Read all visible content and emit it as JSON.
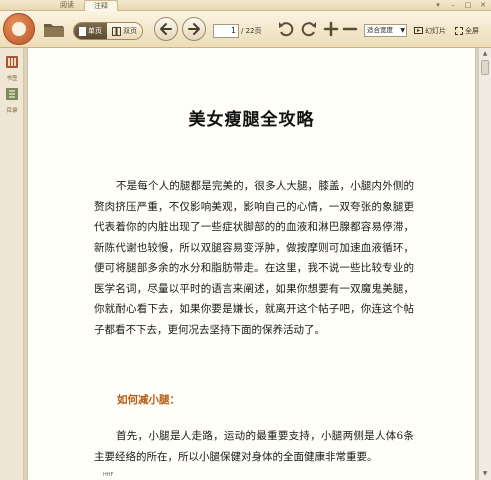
{
  "tabs": {
    "read": "阅读",
    "note": "注释"
  },
  "window_controls": {
    "menu": "▾",
    "minimize": "–",
    "maximize": "□",
    "close": "✕"
  },
  "toolbar": {
    "single_page": "单页",
    "double_page": "双页",
    "current_page": "1",
    "total_pages": "/ 22页",
    "zoom_mode": "适合宽度",
    "slideshow": "幻灯片",
    "fullscreen": "全屏"
  },
  "sidebar": {
    "items": [
      {
        "label": "书签",
        "icon": "bookmark-icon"
      },
      {
        "label": "目录",
        "icon": "toc-icon"
      }
    ]
  },
  "document": {
    "title": "美女瘦腿全攻略",
    "paragraph1": "不是每个人的腿都是完美的，很多人大腿，膝盖，小腿内外侧的赘肉挤压严重，不仅影响美观，影响自己的心情，一双夸张的象腿更代表着你的内脏出现了一些症状脚部的的血液和淋巴腺都容易停滞，新陈代谢也较慢，所以双腿容易变浮肿，做按摩则可加速血液循环，便可将腿部多余的水分和脂肪带走。在这里，我不说一些比较专业的医学名词，尽量以平时的语言来阐述，如果你想要有一双魔鬼美腿，你就耐心看下去，如果你要是嫌长，就离开这个帖子吧，你连这个帖子都看不下去，更何况去坚持下面的保养活动了。",
    "heading1": "如何减小腿：",
    "paragraph2": "首先，小腿是人走路，运动的最重要支持，小腿两侧是人体6条主要经络的所在，所以小腿保健对身体的全面健康非常重要。",
    "footnote": "HHF"
  },
  "colors": {
    "accent": "#b45a10",
    "toolbar": "#ecdcb6",
    "page": "#fffef9"
  }
}
